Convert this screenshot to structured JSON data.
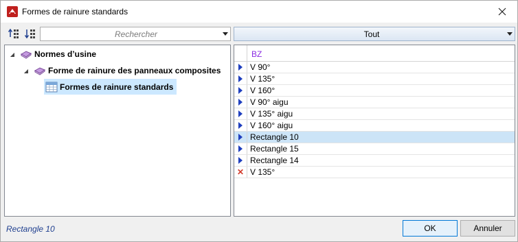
{
  "window": {
    "title": "Formes de rainure standards"
  },
  "toolbar": {
    "search_placeholder": "Rechercher",
    "filter_value": "Tout"
  },
  "tree": {
    "root_label": "Normes d’usine",
    "child_label": "Forme de rainure des panneaux composites",
    "leaf_label": "Formes de rainure standards"
  },
  "grid": {
    "column_header": "BZ",
    "rows": [
      {
        "value": "V 90°",
        "marker": "arrow",
        "selected": false
      },
      {
        "value": "V 135°",
        "marker": "arrow",
        "selected": false
      },
      {
        "value": "V 160°",
        "marker": "arrow",
        "selected": false
      },
      {
        "value": "V 90° aigu",
        "marker": "arrow",
        "selected": false
      },
      {
        "value": "V 135° aigu",
        "marker": "arrow",
        "selected": false
      },
      {
        "value": "V 160° aigu",
        "marker": "arrow",
        "selected": false
      },
      {
        "value": "Rectangle 10",
        "marker": "arrow",
        "selected": true
      },
      {
        "value": "Rectangle 15",
        "marker": "arrow",
        "selected": false
      },
      {
        "value": "Rectangle 14",
        "marker": "arrow",
        "selected": false
      },
      {
        "value": "V 135°",
        "marker": "x",
        "selected": false
      }
    ]
  },
  "footer": {
    "status": "Rectangle 10",
    "ok_label": "OK",
    "cancel_label": "Annuler"
  },
  "colors": {
    "selection": "#cce8ff",
    "row_selection": "#cce4f7",
    "header_text": "#8a2be2",
    "marker_arrow": "#1f3fbf",
    "marker_x": "#d23a2a"
  }
}
